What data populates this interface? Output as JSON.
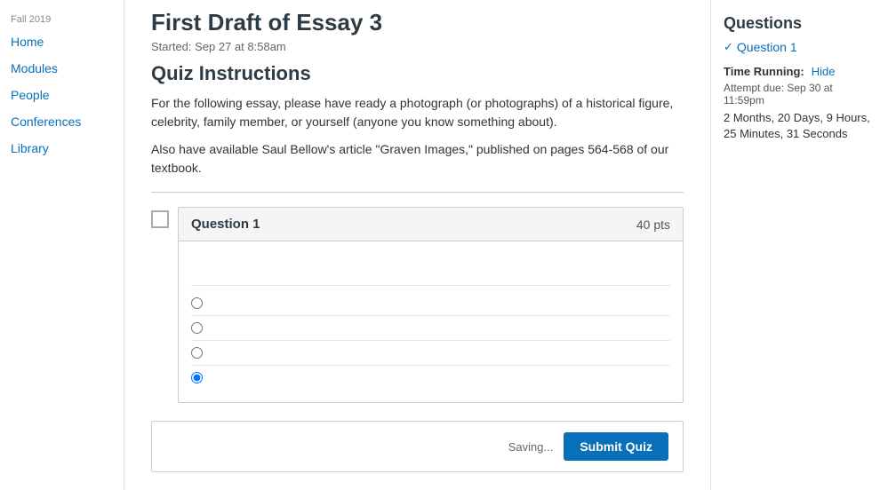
{
  "sidebar": {
    "term": "Fall 2019",
    "items": [
      {
        "label": "Home",
        "name": "home"
      },
      {
        "label": "Modules",
        "name": "modules"
      },
      {
        "label": "People",
        "name": "people"
      },
      {
        "label": "Conferences",
        "name": "conferences"
      },
      {
        "label": "Library",
        "name": "library"
      }
    ]
  },
  "main": {
    "title": "First Draft of Essay 3",
    "started": "Started: Sep 27 at 8:58am",
    "instructions_heading": "Quiz Instructions",
    "instructions_text1": "For the following essay, please have ready a photograph (or photographs) of a historical figure, celebrity, family member, or yourself (anyone you know something about).",
    "instructions_text2": "Also have available Saul Bellow's article \"Graven Images,\" published on pages 564-568 of our textbook.",
    "question": {
      "label": "Question 1",
      "pts": "40 pts",
      "radio_options": [
        {
          "id": "r1",
          "checked": false
        },
        {
          "id": "r2",
          "checked": false
        },
        {
          "id": "r3",
          "checked": false
        },
        {
          "id": "r4",
          "checked": true
        }
      ]
    },
    "bottom_bar": {
      "saving_text": "Saving...",
      "submit_label": "Submit Quiz"
    }
  },
  "right_panel": {
    "heading": "Questions",
    "question_link": "Question 1",
    "time_label": "Time Running:",
    "hide_label": "Hide",
    "attempt_due": "Attempt due: Sep 30 at 11:59pm",
    "time_remaining": "2 Months, 20 Days, 9 Hours, 25 Minutes, 31 Seconds"
  }
}
